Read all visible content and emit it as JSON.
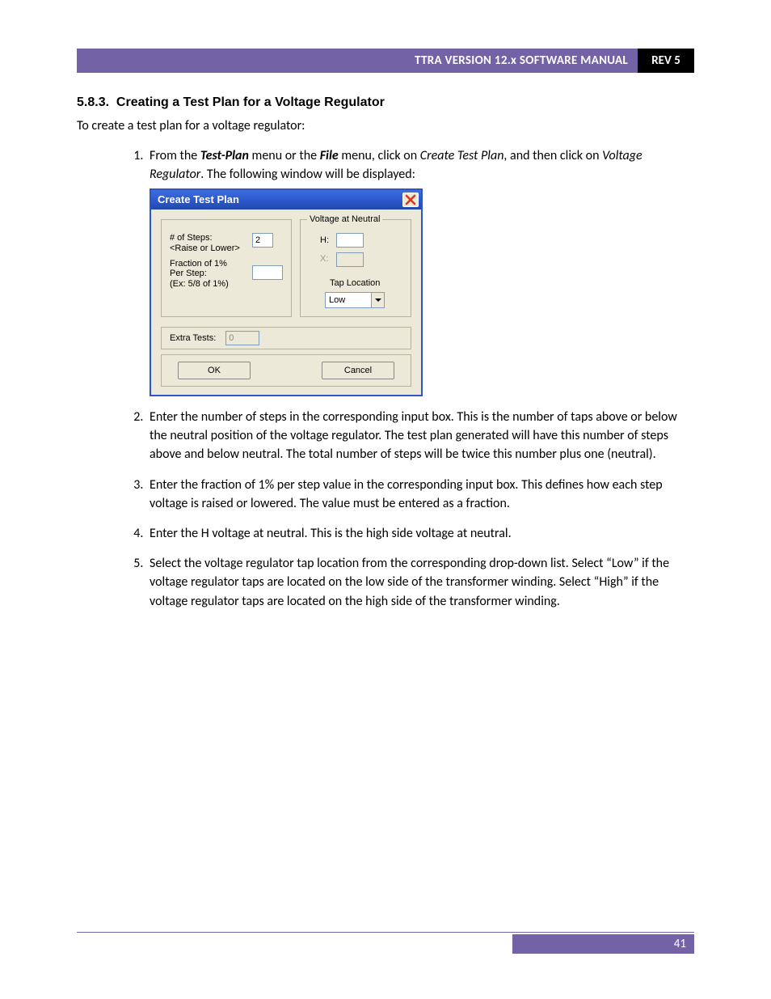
{
  "header": {
    "title": "TTRA VERSION 12.x SOFTWARE MANUAL",
    "rev": "REV 5"
  },
  "section": {
    "number": "5.8.3.",
    "title": "Creating a Test Plan for a Voltage Regulator"
  },
  "intro": "To create a test plan for a voltage regulator:",
  "steps": {
    "s1a": "From the ",
    "s1_tp": "Test-Plan",
    "s1b": " menu or the ",
    "s1_file": "File",
    "s1c": " menu, click on ",
    "s1_ctp": "Create Test Plan",
    "s1d": ", and then click on ",
    "s1_vr": "Voltage Regulator",
    "s1e": ". The following window will be displayed:",
    "s2": "Enter the number of steps in the corresponding input box. This is the number of taps above or below the neutral position of the voltage regulator. The test plan generated will have this number of steps above and below neutral. The total number of steps will be twice this number plus one (neutral).",
    "s3": "Enter the fraction of 1% per step value in the corresponding input box. This defines how each step voltage is raised or lowered. The value must be entered as a fraction.",
    "s4": "Enter the H voltage at neutral. This is the high side voltage at neutral.",
    "s5": "Select the voltage regulator tap location from the corresponding drop-down list. Select “Low” if the voltage regulator taps are located on the low side of the transformer winding. Select “High” if the voltage regulator taps are located on the high side of the transformer winding."
  },
  "dialog": {
    "title": "Create Test Plan",
    "steps_lbl1": "# of Steps:",
    "steps_lbl2": "<Raise or Lower>",
    "steps_val": "2",
    "frac_lbl1": "Fraction of 1%",
    "frac_lbl2": "Per Step:",
    "frac_lbl3": "(Ex: 5/8 of 1%)",
    "frac_val": "",
    "legend_right": "Voltage at Neutral",
    "h_lbl": "H:",
    "h_val": "",
    "x_lbl": "X:",
    "tap_lbl": "Tap Location",
    "tap_val": "Low",
    "extra_lbl": "Extra Tests:",
    "extra_val": "0",
    "ok": "OK",
    "cancel": "Cancel"
  },
  "footer": {
    "page": "41"
  }
}
